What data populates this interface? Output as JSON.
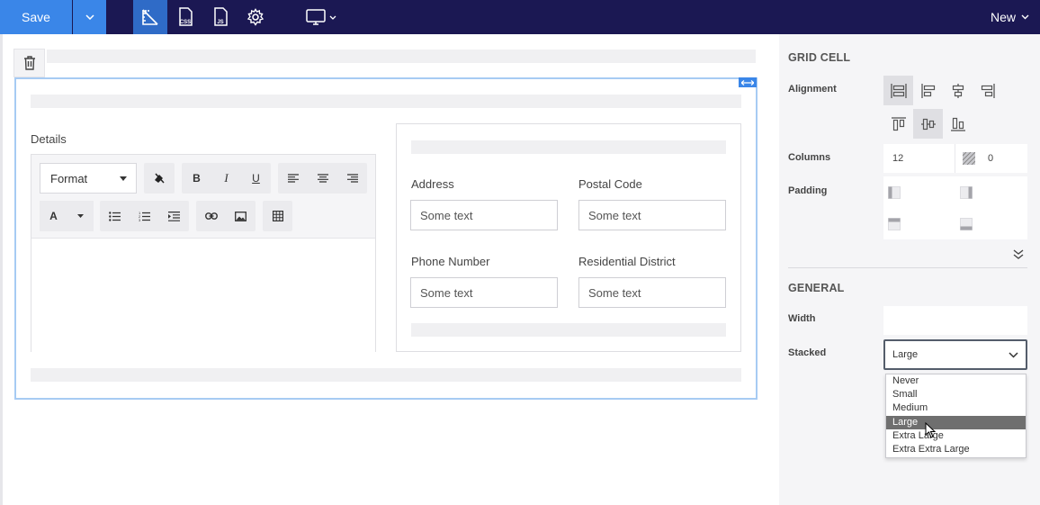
{
  "toolbar": {
    "save_label": "Save",
    "new_label": "New",
    "icons": [
      "layout-icon",
      "css-icon",
      "js-icon",
      "gear-icon",
      "monitor-icon"
    ],
    "css_text": "CSS",
    "js_text": "JS"
  },
  "editor": {
    "details_label": "Details",
    "format_label": "Format",
    "bold": "B",
    "italic": "I",
    "underline": "U",
    "font_color": "A"
  },
  "form": {
    "fields": [
      {
        "label": "Address",
        "placeholder": "Some text"
      },
      {
        "label": "Postal Code",
        "placeholder": "Some text"
      },
      {
        "label": "Phone Number",
        "placeholder": "Some text"
      },
      {
        "label": "Residential District",
        "placeholder": "Some text"
      }
    ]
  },
  "panel": {
    "grid_cell_heading": "GRID CELL",
    "alignment_label": "Alignment",
    "columns_label": "Columns",
    "columns_value": "12",
    "offset_value": "0",
    "padding_label": "Padding",
    "general_heading": "GENERAL",
    "width_label": "Width",
    "stacked_label": "Stacked",
    "stacked_value": "Large",
    "stacked_options": [
      "Never",
      "Small",
      "Medium",
      "Large",
      "Extra Large",
      "Extra Extra Large"
    ]
  },
  "colors": {
    "topbar": "#1b1853",
    "accent": "#3a86e8",
    "selection": "#a7cbf3"
  }
}
